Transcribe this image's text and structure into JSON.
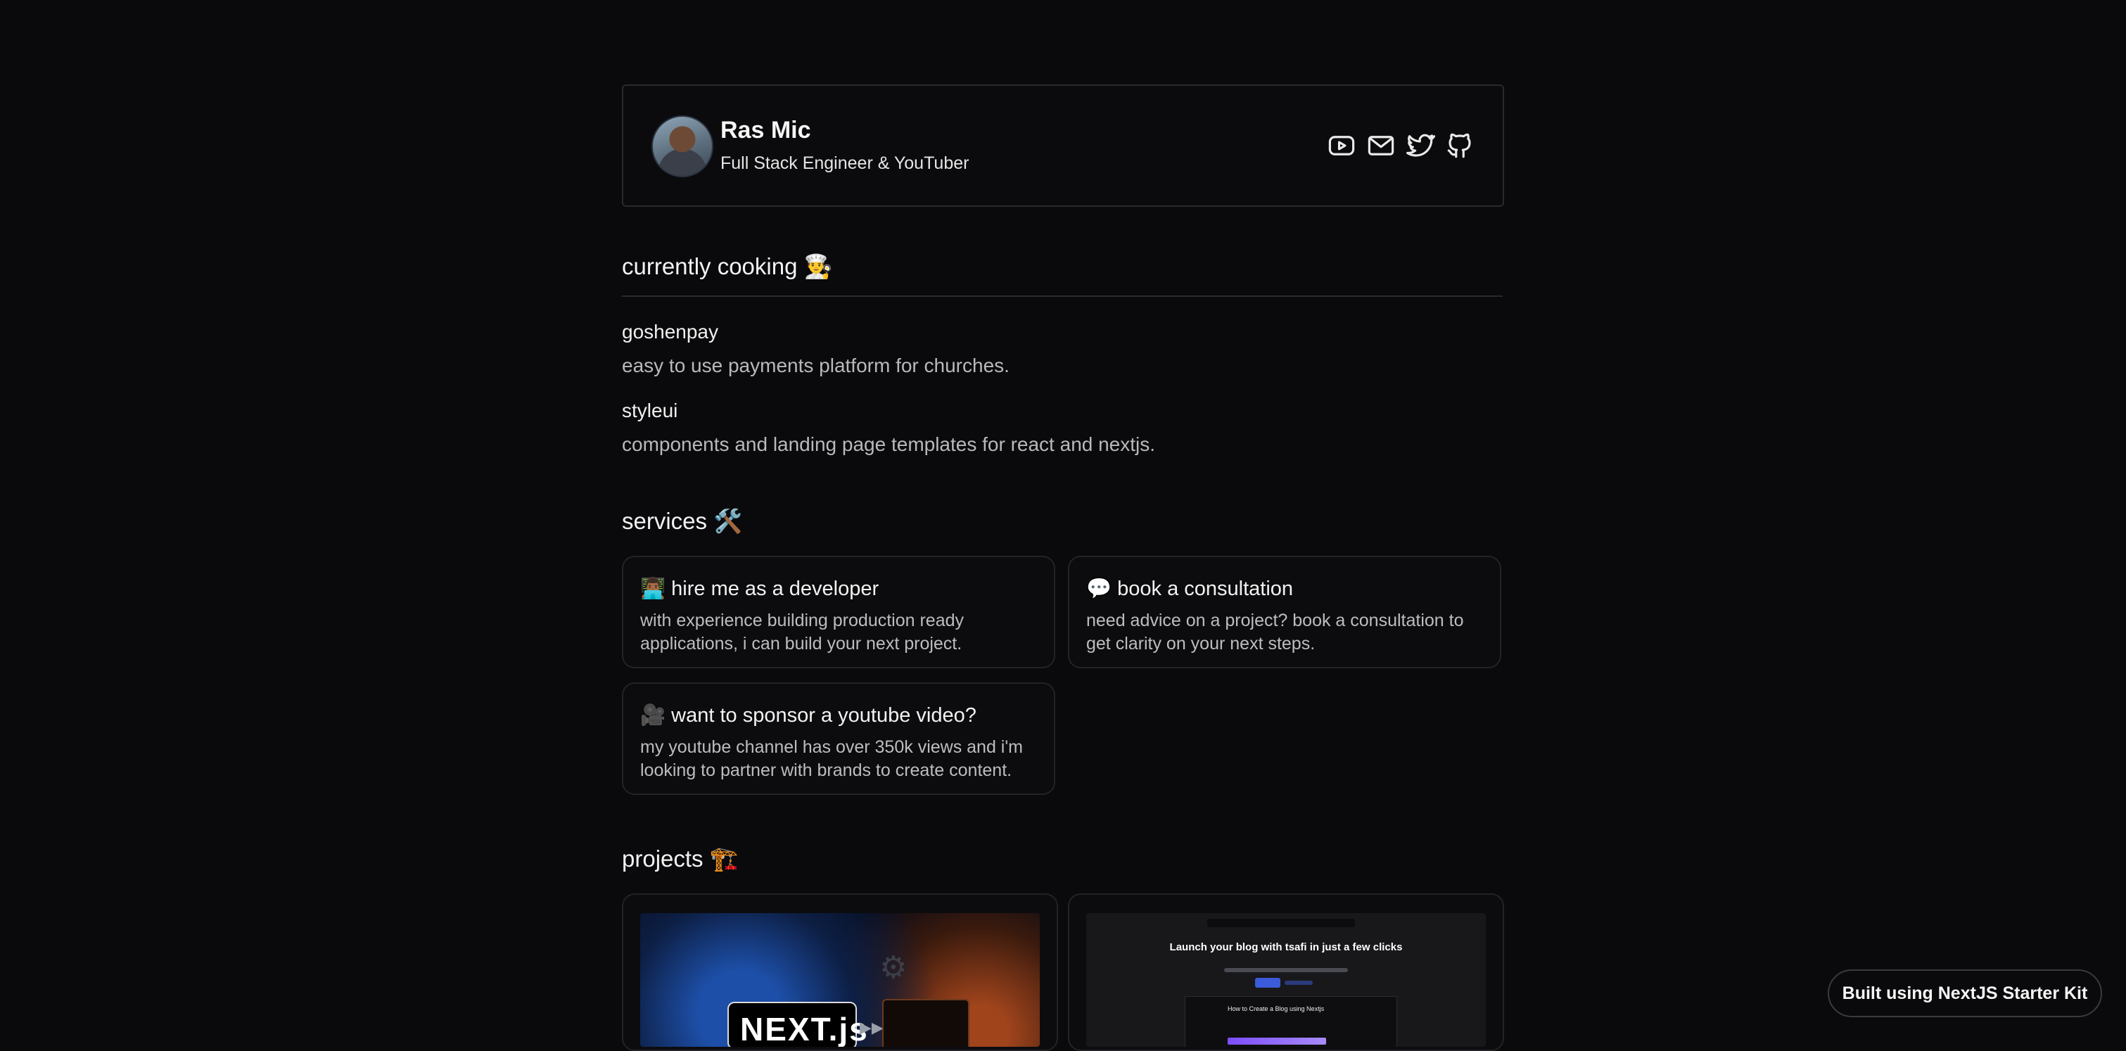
{
  "profile": {
    "name": "Ras Mic",
    "tagline": "Full Stack Engineer & YouTuber",
    "social_icons": [
      "youtube-icon",
      "mail-icon",
      "twitter-icon",
      "github-icon"
    ]
  },
  "currently_cooking": {
    "heading": "currently cooking 👨‍🍳",
    "items": [
      {
        "name": "goshenpay",
        "description": "easy to use payments platform for churches."
      },
      {
        "name": "styleui",
        "description": "components and landing page templates for react and nextjs."
      }
    ]
  },
  "services": {
    "heading": "services 🛠️",
    "cards": [
      {
        "title": "👨🏾‍💻 hire me as a developer",
        "description": "with experience building production ready applications, i can build your next project."
      },
      {
        "title": "💬 book a consultation",
        "description": "need advice on a project? book a consultation to get clarity on your next steps."
      },
      {
        "title": "🎥 want to sponsor a youtube video?",
        "description": "my youtube channel has over 350k views and i'm looking to partner with brands to create content."
      }
    ]
  },
  "projects": {
    "heading": "projects 🏗️",
    "items": [
      {
        "thumbnail_text": "NEXT.js"
      },
      {
        "thumbnail_text": "Launch your blog with tsafi in just a few clicks",
        "panel_text": "How to Create a Blog using Nextjs"
      }
    ]
  },
  "badge": {
    "label": "Built using NextJS Starter Kit"
  },
  "colors": {
    "background": "#0a0a0c",
    "border": "#2a2a2e",
    "muted_text": "#b9b9bd"
  }
}
